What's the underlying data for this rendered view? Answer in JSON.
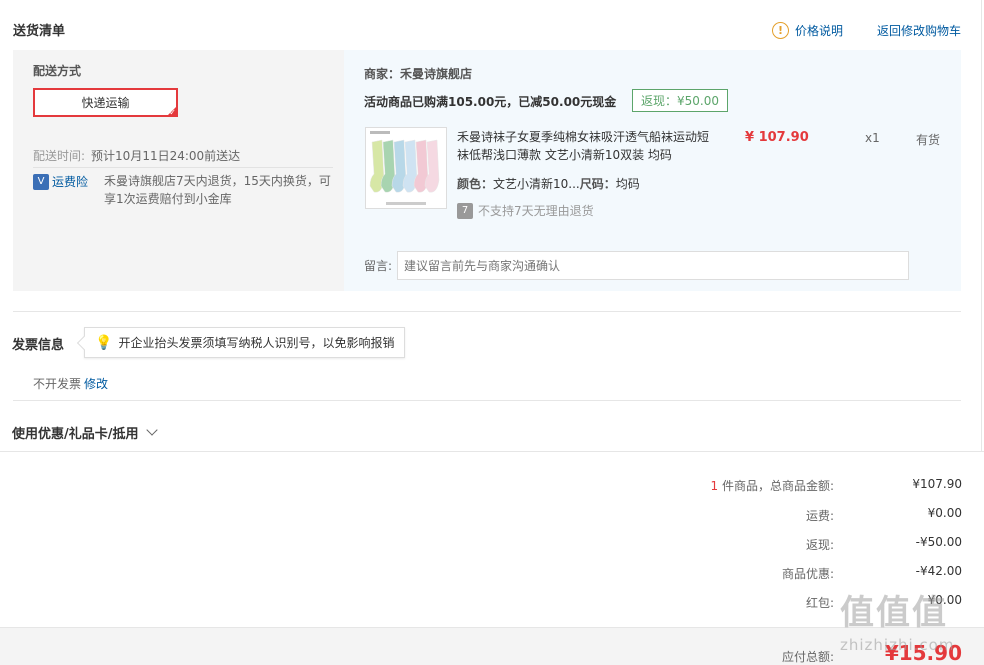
{
  "header": {
    "title": "送货清单",
    "price_note": "价格说明",
    "back_to_cart": "返回修改购物车"
  },
  "shipping": {
    "method_label": "配送方式",
    "method_value": "快递运输",
    "time_label": "配送时间:",
    "time_value": "预计10月11日24:00前送达",
    "insurance_label": "运费险",
    "insurance_text": "禾曼诗旗舰店7天内退货，15天内换货，可享1次运费赔付到小金库"
  },
  "shop": {
    "name": "商家：禾曼诗旗舰店",
    "promo": "活动商品已购满105.00元，已减50.00元现金",
    "rebate": "返现：¥50.00"
  },
  "product": {
    "name": "禾曼诗袜子女夏季纯棉女袜吸汗透气船袜运动短袜低帮浅口薄款 文艺小清新10双装 均码",
    "color_label": "颜色：",
    "color_value": "文艺小清新10...",
    "size_label": "尺码：",
    "size_value": "均码",
    "no_return": "不支持7天无理由退货",
    "price": "¥ 107.90",
    "qty": "x1",
    "stock": "有货",
    "swatch_colors": [
      "#d7e7a6",
      "#a8d4b0",
      "#b8d8e8",
      "#cfe3f2",
      "#f2c9d4",
      "#f5d9e2"
    ]
  },
  "remark": {
    "label": "留言:",
    "placeholder": "建议留言前先与商家沟通确认"
  },
  "invoice": {
    "title": "发票信息",
    "tip": "开企业抬头发票须填写纳税人识别号，以免影响报销",
    "status": "不开发票",
    "modify": "修改"
  },
  "coupon": {
    "label": "使用优惠/礼品卡/抵用"
  },
  "summary": {
    "count": "1",
    "items_label": " 件商品，总商品金额:",
    "items_value": "¥107.90",
    "shipping_label": "运费:",
    "shipping_value": "¥0.00",
    "rebate_label": "返现:",
    "rebate_value": "-¥50.00",
    "discount_label": "商品优惠:",
    "discount_value": "-¥42.00",
    "redpacket_label": "红包:",
    "redpacket_value": "¥0.00",
    "total_label": "应付总额:",
    "total_value": "¥15.90"
  },
  "watermark": {
    "logo": "值值值",
    "url": "zhizhizhi.com"
  },
  "colors": {
    "accent_red": "#e4393c",
    "link_blue": "#005aa0",
    "rebate_green": "#5ca56a"
  }
}
